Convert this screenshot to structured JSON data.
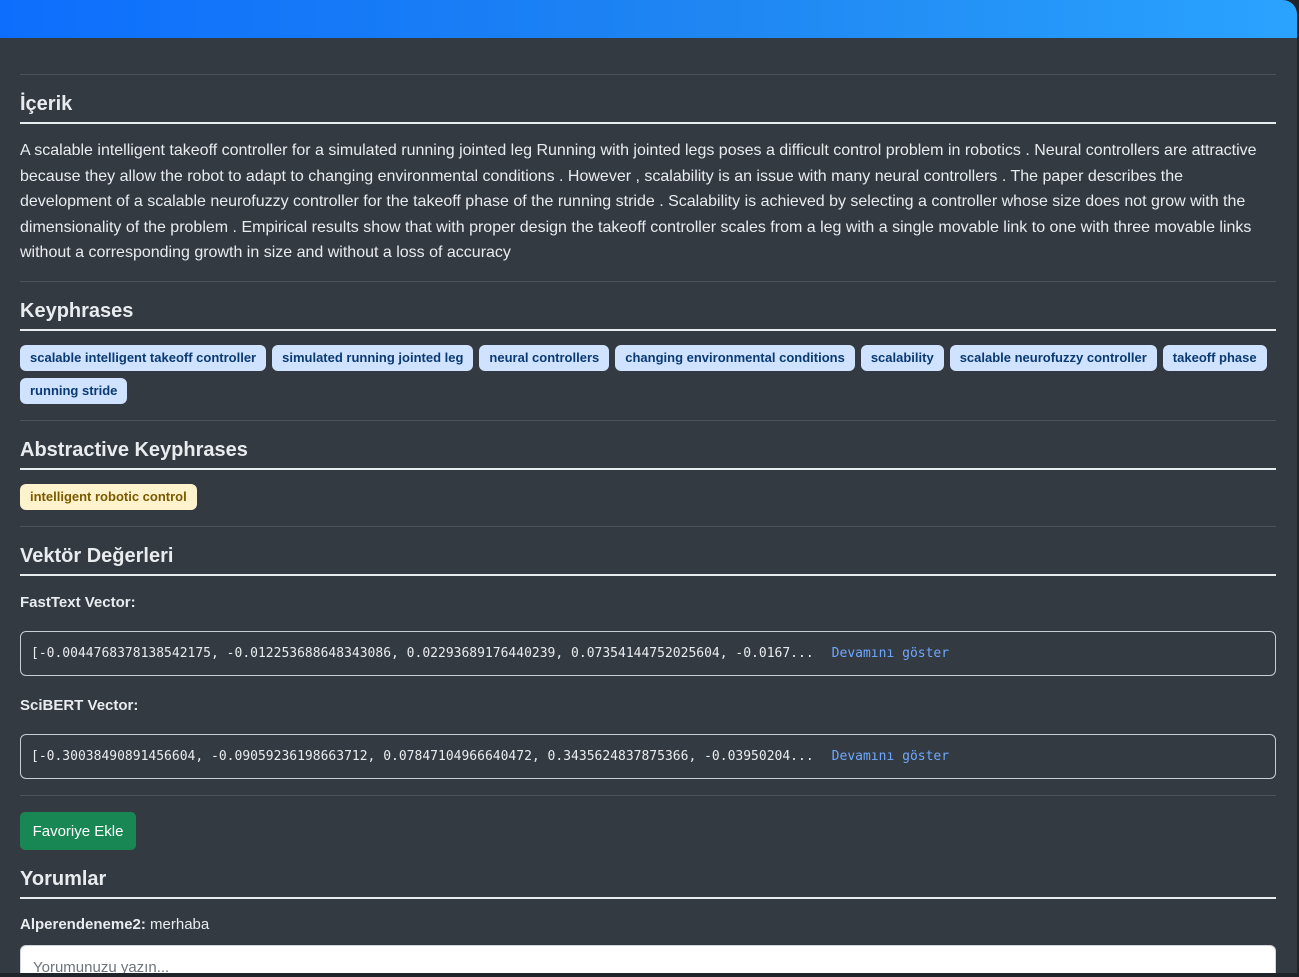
{
  "sections": {
    "content_title": "İçerik",
    "content_text": "A scalable intelligent takeoff controller for a simulated running jointed leg Running with jointed legs poses a difficult control problem in robotics . Neural controllers are attractive because they allow the robot to adapt to changing environmental conditions . However , scalability is an issue with many neural controllers . The paper describes the development of a scalable neurofuzzy controller for the takeoff phase of the running stride . Scalability is achieved by selecting a controller whose size does not grow with the dimensionality of the problem . Empirical results show that with proper design the takeoff controller scales from a leg with a single movable link to one with three movable links without a corresponding growth in size and without a loss of accuracy",
    "keyphrases_title": "Keyphrases",
    "keyphrases": [
      "scalable intelligent takeoff controller",
      "simulated running jointed leg",
      "neural controllers",
      "changing environmental conditions",
      "scalability",
      "scalable neurofuzzy controller",
      "takeoff phase",
      "running stride"
    ],
    "abstractive_title": "Abstractive Keyphrases",
    "abstractive_keyphrases": [
      "intelligent robotic control"
    ],
    "vectors_title": "Vektör Değerleri",
    "fasttext_label": "FastText Vector:",
    "fasttext_value": "[-0.0044768378138542175, -0.012253688648343086, 0.02293689176440239, 0.07354144752025604, -0.0167...",
    "scibert_label": "SciBERT Vector:",
    "scibert_value": "[-0.30038490891456604, -0.09059236198663712, 0.07847104966640472, 0.3435624837875366, -0.03950204...",
    "show_more": "Devamını göster",
    "favorite_button": "Favoriye Ekle",
    "comments_title": "Yorumlar",
    "comment_user": "Alperendeneme2:",
    "comment_text": " merhaba",
    "comment_placeholder": "Yorumunuzu yazın..."
  }
}
